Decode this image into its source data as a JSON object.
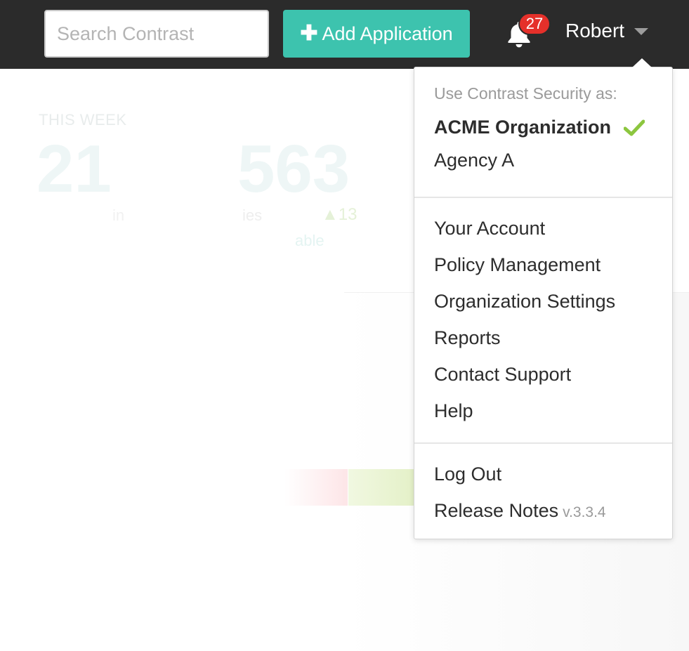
{
  "header": {
    "search_placeholder": "Search Contrast",
    "add_application_label": "Add Application",
    "add_application_icon": "plus-icon",
    "notification_icon": "bell-icon",
    "notification_count": "27",
    "user_name": "Robert",
    "caret_icon": "caret-down-icon"
  },
  "background": {
    "week_label": "THIS WEEK",
    "stat1_value": "21",
    "stat1_sub": "in",
    "stat2_value": "563",
    "stat2_sub": "ies",
    "stat2_change": "▲13",
    "stat2_sub2": "able"
  },
  "dropdown": {
    "heading": "Use Contrast Security as:",
    "organizations": [
      {
        "label": "ACME Organization",
        "selected": true
      },
      {
        "label": "Agency A",
        "selected": false
      }
    ],
    "menu": [
      {
        "label": "Your Account"
      },
      {
        "label": "Policy Management"
      },
      {
        "label": "Organization Settings"
      },
      {
        "label": "Reports"
      },
      {
        "label": "Contact Support"
      },
      {
        "label": "Help"
      }
    ],
    "logout_label": "Log Out",
    "release_notes_label": "Release Notes",
    "version": "v.3.3.4"
  },
  "colors": {
    "topbar": "#2b2b2b",
    "accent": "#3dc3ae",
    "badge": "#e5302a",
    "check": "#8cc63f"
  }
}
